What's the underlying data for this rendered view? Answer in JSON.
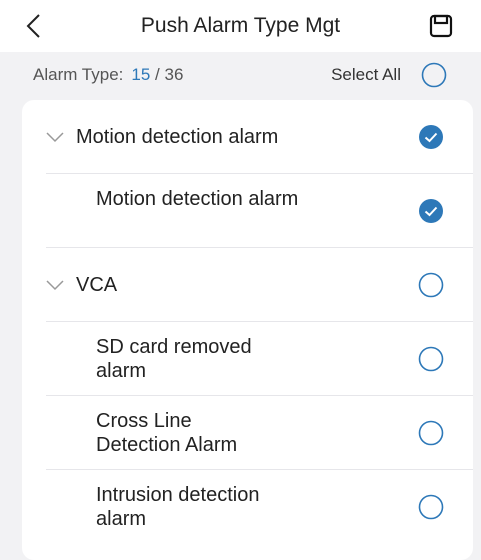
{
  "header": {
    "title": "Push Alarm Type Mgt",
    "back_icon": "chevron-left-icon",
    "save_icon": "save-icon"
  },
  "summary": {
    "label": "Alarm Type:",
    "selected": "15",
    "total": "/ 36",
    "select_all_label": "Select All",
    "select_all_checked": false
  },
  "colors": {
    "accent": "#2d78b8",
    "checked_fill": "#2d78b8",
    "unchecked_stroke": "#2d78b8"
  },
  "groups": [
    {
      "label": "Motion detection alarm",
      "checked": true,
      "items": [
        {
          "label": "Motion detection alarm",
          "checked": true
        }
      ]
    },
    {
      "label": "VCA",
      "checked": false,
      "items": [
        {
          "label": "SD card removed alarm",
          "checked": false
        },
        {
          "label": "Cross Line Detection Alarm",
          "checked": false
        },
        {
          "label": "Intrusion detection alarm",
          "checked": false
        }
      ]
    }
  ]
}
